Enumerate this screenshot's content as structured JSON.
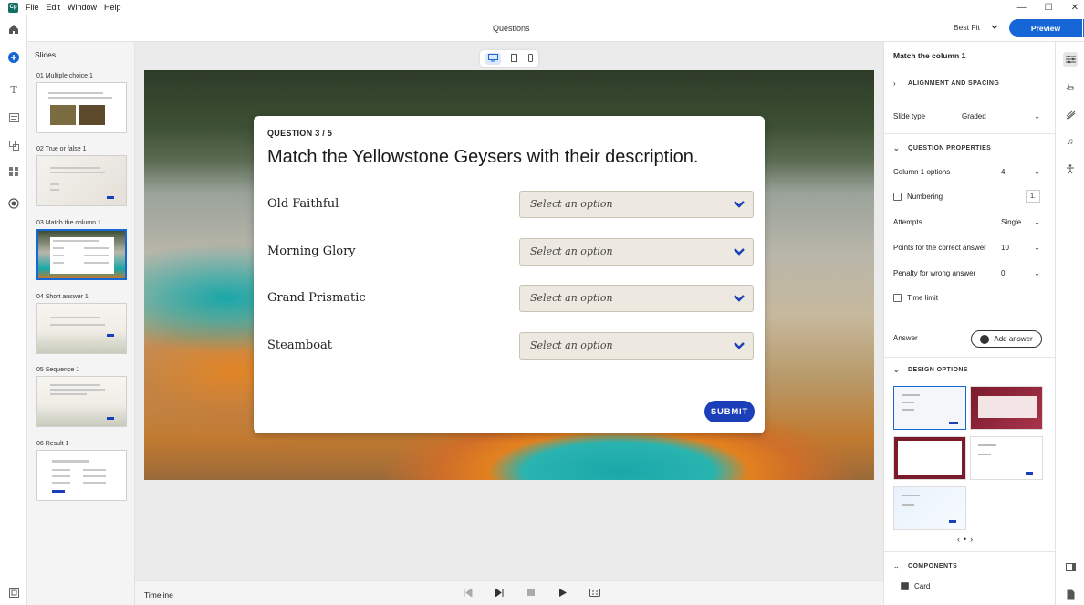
{
  "menu": {
    "logo": "Cp",
    "items": [
      "File",
      "Edit",
      "Window",
      "Help"
    ]
  },
  "window_controls": {
    "minimize": "—",
    "maximize": "☐",
    "close": "✕"
  },
  "toolbar": {
    "title": "Questions",
    "zoom": "Best Fit",
    "preview": "Preview",
    "more": "•••"
  },
  "slides_panel": {
    "title": "Slides",
    "slides": [
      {
        "label": "01  Multiple choice 1"
      },
      {
        "label": "02  True or false 1"
      },
      {
        "label": "03  Match the column 1"
      },
      {
        "label": "04  Short answer 1"
      },
      {
        "label": "05  Sequence 1"
      },
      {
        "label": "06  Result 1"
      }
    ]
  },
  "slide": {
    "counter": "QUESTION 3 / 5",
    "title": "Match the Yellowstone Geysers with their description.",
    "rows": [
      {
        "label": "Old Faithful",
        "placeholder": "Select an option"
      },
      {
        "label": "Morning Glory",
        "placeholder": "Select an option"
      },
      {
        "label": "Grand Prismatic",
        "placeholder": "Select an option"
      },
      {
        "label": "Steamboat",
        "placeholder": "Select an option"
      }
    ],
    "submit": "SUBMIT"
  },
  "timeline": {
    "label": "Timeline"
  },
  "properties": {
    "title": "Match the column 1",
    "alignment_section": "ALIGNMENT AND SPACING",
    "slide_type_label": "Slide type",
    "slide_type_value": "Graded",
    "question_properties_section": "QUESTION PROPERTIES",
    "column1_label": "Column 1 options",
    "column1_value": "4",
    "numbering_label": "Numbering",
    "numbering_value": "1.",
    "attempts_label": "Attempts",
    "attempts_value": "Single",
    "points_label": "Points for the correct answer",
    "points_value": "10",
    "penalty_label": "Penalty for wrong answer",
    "penalty_value": "0",
    "time_limit_label": "Time limit",
    "answer_label": "Answer",
    "add_answer": "Add answer",
    "design_section": "DESIGN OPTIONS",
    "components_section": "COMPONENTS",
    "card_label": "Card"
  },
  "colors": {
    "accent": "#1766d6",
    "submit": "#1a3fb8",
    "select_bg": "#ede9e0"
  }
}
